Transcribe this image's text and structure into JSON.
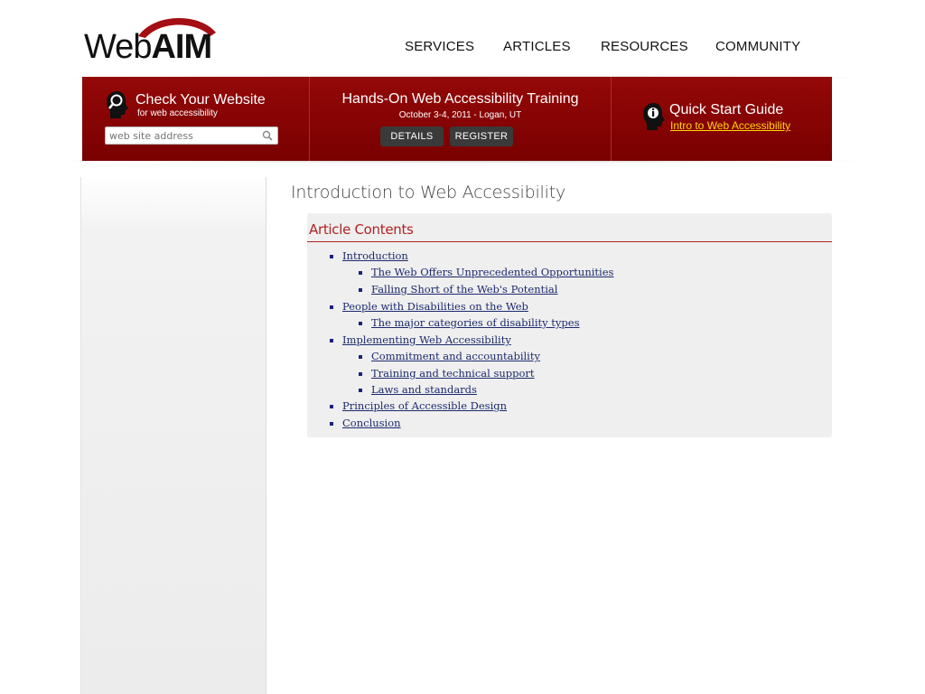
{
  "logo": {
    "text_prefix": "Web",
    "text_suffix": "AIM"
  },
  "nav": [
    {
      "label": "SERVICES"
    },
    {
      "label": "ARTICLES"
    },
    {
      "label": "RESOURCES"
    },
    {
      "label": "COMMUNITY"
    }
  ],
  "banner": {
    "check": {
      "title": "Check Your Website",
      "subtitle": "for web accessibility",
      "search_placeholder": "web site address"
    },
    "training": {
      "title": "Hands-On Web Accessibility Training",
      "date": "October 3-4, 2011 - Logan, UT",
      "details_label": "DETAILS",
      "register_label": "REGISTER"
    },
    "quickstart": {
      "title": "Quick Start Guide",
      "link": "Intro to Web Accessibility"
    }
  },
  "main": {
    "title": "Introduction to Web Accessibility",
    "toc": {
      "heading": "Article Contents",
      "items": [
        {
          "label": "Introduction"
        },
        {
          "label": "The Web Offers Unprecedented Opportunities"
        },
        {
          "label": "Falling Short of the Web's Potential"
        },
        {
          "label": "People with Disabilities on the Web"
        },
        {
          "label": "The major categories of disability types"
        },
        {
          "label": "Implementing Web Accessibility"
        },
        {
          "label": "Commitment and accountability"
        },
        {
          "label": "Training and technical support"
        },
        {
          "label": "Laws and standards"
        },
        {
          "label": "Principles of Accessible Design"
        },
        {
          "label": "Conclusion"
        }
      ]
    }
  },
  "colors": {
    "brand_red": "#8a0000",
    "link_blue": "#1c2a6e",
    "heading_red": "#b22222",
    "quickstart_link": "#ffd400"
  }
}
